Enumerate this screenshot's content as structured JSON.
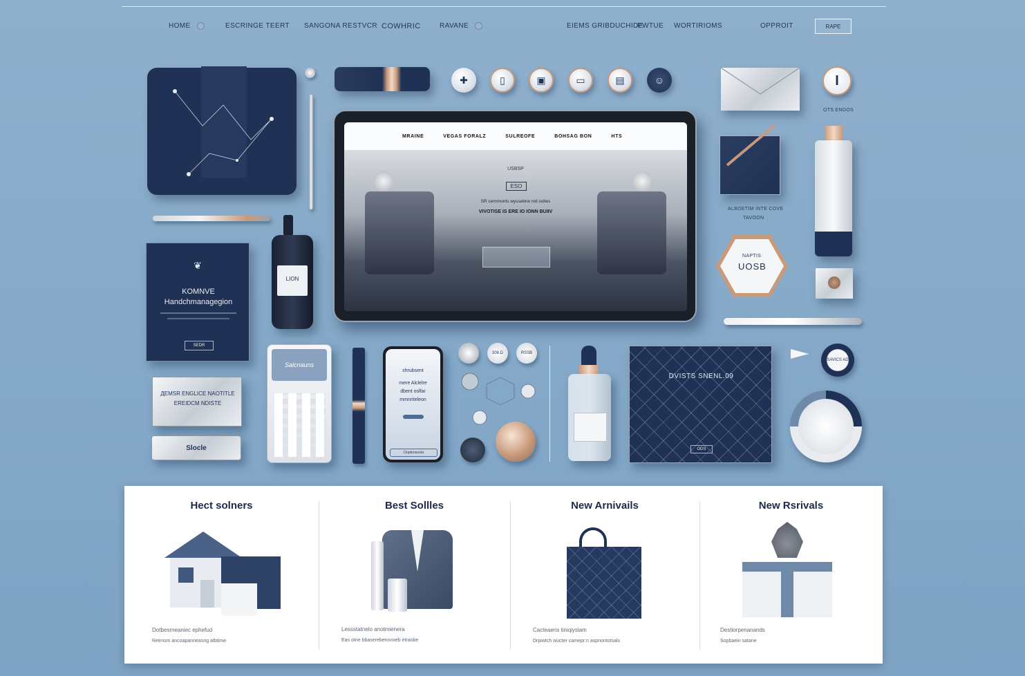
{
  "nav": {
    "items": [
      {
        "label": "HOME",
        "icon": "circle-dot-icon"
      },
      {
        "label": "ESCRINGE TEERT"
      },
      {
        "label": "SANGONA RESTVCR"
      },
      {
        "label": "COWHRIC"
      },
      {
        "label": "RAVANE",
        "icon": "circle-dot-icon"
      },
      {
        "label": "EIEMS GRIBDUCHIDE"
      },
      {
        "label": "PWTUE"
      },
      {
        "label": "WORTIRIOMS"
      },
      {
        "label": "OPPROIT"
      }
    ],
    "button_label": "RAPE"
  },
  "scene": {
    "book_title": "KOMNVE",
    "book_subtitle": "Handchmanagegion",
    "book_badge": "SEDR",
    "bottle_label": "LION",
    "plate_line1": "ДEMSR ENGLICE NAOTITLE",
    "plate_line2": "EREIDCM NDISTE",
    "slider_label": "Slocle",
    "calc_screen": "Salcnauns",
    "phone_line1": "shrubsent",
    "phone_line2": "mere Alclelre",
    "phone_line3": "dbent oslfar",
    "phone_line4": "mmnriteleon",
    "phone_footer": "Cloptonsocks",
    "quilted_title": "DVISTS SNENL.09",
    "quilted_badge": "ODS",
    "envelope_caption": "OTS ENDOS",
    "square_caption_1": "ALBOETIM INTE COVE",
    "square_caption_2": "TAVOON",
    "hex_top": "NAPTIS",
    "hex_main": "UOSB",
    "round_badge": "SAVICS AD",
    "small_badges": [
      "308.D",
      "RSSB"
    ],
    "colors": {
      "navy": "#1f3154",
      "accent_copper": "#c89a7c",
      "background": "#86a9c8"
    }
  },
  "tablet": {
    "nav": [
      "MRAINE",
      "VEGAS FORALZ",
      "SULREOFE",
      "BOHSAG BON",
      "HTS"
    ],
    "hero_price_small": "USBSP",
    "hero_price_box": "ESO",
    "hero_line1": "SR cemmonts wyssebne nid soltes",
    "hero_line2": "VIVOTISE IS ERE IO IONN BUIIV"
  },
  "panel": {
    "columns": [
      {
        "title": "Hect solners",
        "caption1": "Dotbesrneaniec ephefud",
        "caption2": "Retrnsm ancoapanneasng atbtime"
      },
      {
        "title": "Best Sollles",
        "caption1": "Lessstatnelo anotmienera",
        "caption2": "Eas otne bbaserebenonxeb etraobe"
      },
      {
        "title": "New Arnivails",
        "caption1": "Cacteaens tiniqiyslam",
        "caption2": "Drpiwtch wucter camepr:n aspnontotsals"
      },
      {
        "title": "New Rsrivals",
        "caption1": "Destiorpenanands",
        "caption2": "Sopbaein satane"
      }
    ]
  }
}
